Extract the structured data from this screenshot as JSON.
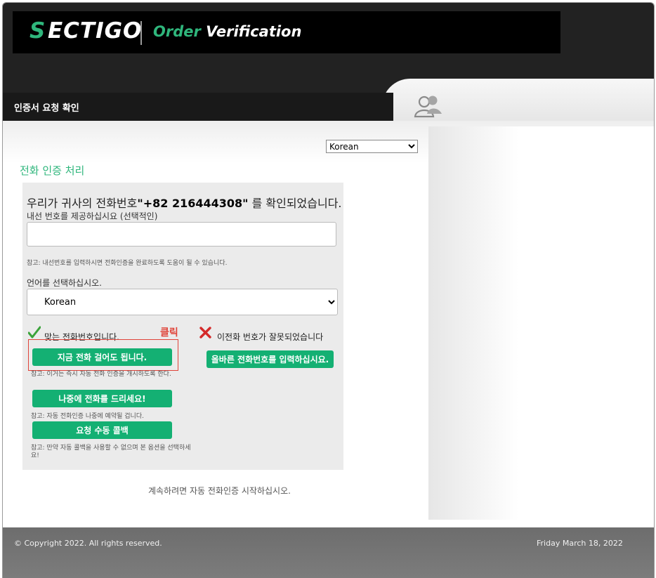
{
  "header": {
    "logo_s": "S",
    "logo_rest": "ECTIGO",
    "title_part1": "Order",
    "title_part2": " Verification"
  },
  "tab": {
    "label": "인증서 요청 확인",
    "icon": "people-icon"
  },
  "language_top": {
    "selected": "Korean"
  },
  "page_title": "전화 인증 처리",
  "verification": {
    "msg_prefix": "우리가 귀사의 전화번호",
    "phone_quoted": "\"+82 216444308\"",
    "msg_suffix": " 를 확인되었습니다.",
    "extension_label": "내선 번호를 제공하십시요 (선택적인)",
    "extension_value": "",
    "extension_note": "참고: 내선번호를 입력하시면 전화인증을 완료하도록 도움이 될 수 있습니다.",
    "language_label": "언어를 선택하십시오.",
    "language_selected": "Korean",
    "correct_label": "맞는 전화번호입니다.",
    "wrong_label": "이전화 번호가 잘못되었습니다",
    "click_annotation": "클릭",
    "call_now_button": "지금 전화 걸어도 됩니다.",
    "call_now_note": "참고: 이거는 즉시 자동 전화 인증을 개시하도록 한다.",
    "wrong_button": "올바른 전화번호를 입력하십시요.",
    "call_later_button": "나중에 전화를 드리세요!",
    "call_later_note": "참고: 자동 전화인증 나중에 예약될 겁니다.",
    "manual_button": "요청 수동 콜백",
    "manual_note_line1": "참고: 만약 자동 콜백을 사용할 수 없으며 본 옵션을 선택하세",
    "manual_note_line2": "요!"
  },
  "continue_text": "계속하려면 자동 전화인증 시작하십시오.",
  "footer": {
    "copyright": "© Copyright 2022. All rights reserved.",
    "date": "Friday March 18, 2022"
  },
  "colors": {
    "brand_green": "#2fb67c",
    "button_green": "#14b073",
    "annotation_red": "#e0443a"
  }
}
